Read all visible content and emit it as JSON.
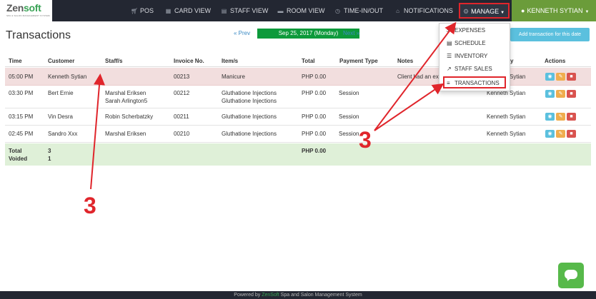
{
  "app": {
    "logo_main": "Zen",
    "logo_accent": "soft",
    "logo_tagline": "SPA & SALON MANAGEMENT SYSTEM"
  },
  "nav": {
    "items": [
      {
        "label": "POS",
        "icon": "cart-icon"
      },
      {
        "label": "CARD VIEW",
        "icon": "grid-icon"
      },
      {
        "label": "STAFF VIEW",
        "icon": "calendar-icon"
      },
      {
        "label": "ROOM VIEW",
        "icon": "bed-icon"
      },
      {
        "label": "TIME-IN/OUT",
        "icon": "clock-icon"
      },
      {
        "label": "NOTIFICATIONS",
        "icon": "bell-icon"
      }
    ],
    "manage_label": "MANAGE",
    "user_label": "KENNETH SYTIAN"
  },
  "manage_menu": [
    {
      "label": "EXPENSES",
      "icon": "dollar-icon"
    },
    {
      "label": "SCHEDULE",
      "icon": "calendar-icon"
    },
    {
      "label": "INVENTORY",
      "icon": "list-icon"
    },
    {
      "label": "STAFF SALES",
      "icon": "chart-line-icon"
    },
    {
      "label": "TRANSACTIONS",
      "icon": "bars-icon"
    }
  ],
  "page": {
    "title": "Transactions",
    "prev_label": "« Prev",
    "date_label": "Sep 25, 2017 (Monday)",
    "next_label": "Next »",
    "add_button": "Add transaction for this date"
  },
  "table": {
    "headers": [
      "Time",
      "Customer",
      "Staff/s",
      "Invoice No.",
      "Item/s",
      "Total",
      "Payment Type",
      "Notes",
      "y",
      "Actions"
    ],
    "rows": [
      {
        "time": "05:00 PM",
        "customer": "Kenneth Sytian",
        "staff": [
          "",
          ""
        ],
        "invoice": "00213",
        "items": [
          "Manicure",
          ""
        ],
        "total": "PHP 0.00",
        "payment": "",
        "notes": "Client had an ex",
        "by": "Kenneth Sytian"
      },
      {
        "time": "03:30 PM",
        "customer": "Bert Ernie",
        "staff": [
          "Marshal Eriksen",
          "Sarah Arlington5"
        ],
        "invoice": "00212",
        "items": [
          "Gluthatione Injections",
          "Gluthatione Injections"
        ],
        "total": "PHP 0.00",
        "payment": "Session",
        "notes": "",
        "by": "Kenneth Sytian"
      },
      {
        "time": "03:15 PM",
        "customer": "Vin Desra",
        "staff": [
          "Robin Scherbatzky",
          ""
        ],
        "invoice": "00211",
        "items": [
          "Gluthatione Injections",
          ""
        ],
        "total": "PHP 0.00",
        "payment": "Session",
        "notes": "",
        "by": "Kenneth Sytian"
      },
      {
        "time": "02:45 PM",
        "customer": "Sandro Xxx",
        "staff": [
          "Marshal Eriksen",
          ""
        ],
        "invoice": "00210",
        "items": [
          "Gluthatione Injections",
          ""
        ],
        "total": "PHP 0.00",
        "payment": "Session",
        "notes": "",
        "by": "Kenneth Sytian"
      }
    ],
    "totals": {
      "total_label": "Total",
      "total_count": "3",
      "voided_label": "Voided",
      "voided_count": "1",
      "total_amount": "PHP 0.00"
    }
  },
  "annotations": {
    "left_number": "3",
    "right_number": "3",
    "color": "#e0252b"
  },
  "footer": {
    "prefix": "Powered by ",
    "brand": "ZenSoft",
    "suffix": " Spa and Salon Management System"
  },
  "colors": {
    "navbar": "#232732",
    "user_green": "#6b9c3a",
    "date_green": "#0d9a3b",
    "add_blue": "#5bc0de",
    "voided_row": "#f2dede",
    "totals_row": "#dff0d8"
  }
}
